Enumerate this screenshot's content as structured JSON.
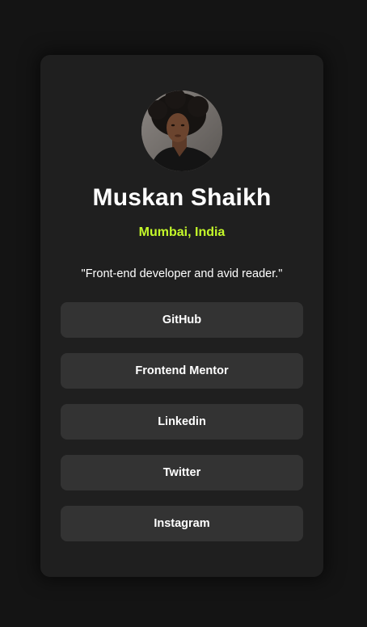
{
  "profile": {
    "name": "Muskan Shaikh",
    "location": "Mumbai, India",
    "bio": "\"Front-end developer and avid reader.\""
  },
  "links": [
    {
      "label": "GitHub"
    },
    {
      "label": "Frontend Mentor"
    },
    {
      "label": "Linkedin"
    },
    {
      "label": "Twitter"
    },
    {
      "label": "Instagram"
    }
  ],
  "colors": {
    "page_background": "#141414",
    "card_background": "#1f1f1f",
    "button_background": "#333333",
    "accent": "#c4f82a",
    "text": "#ffffff"
  }
}
